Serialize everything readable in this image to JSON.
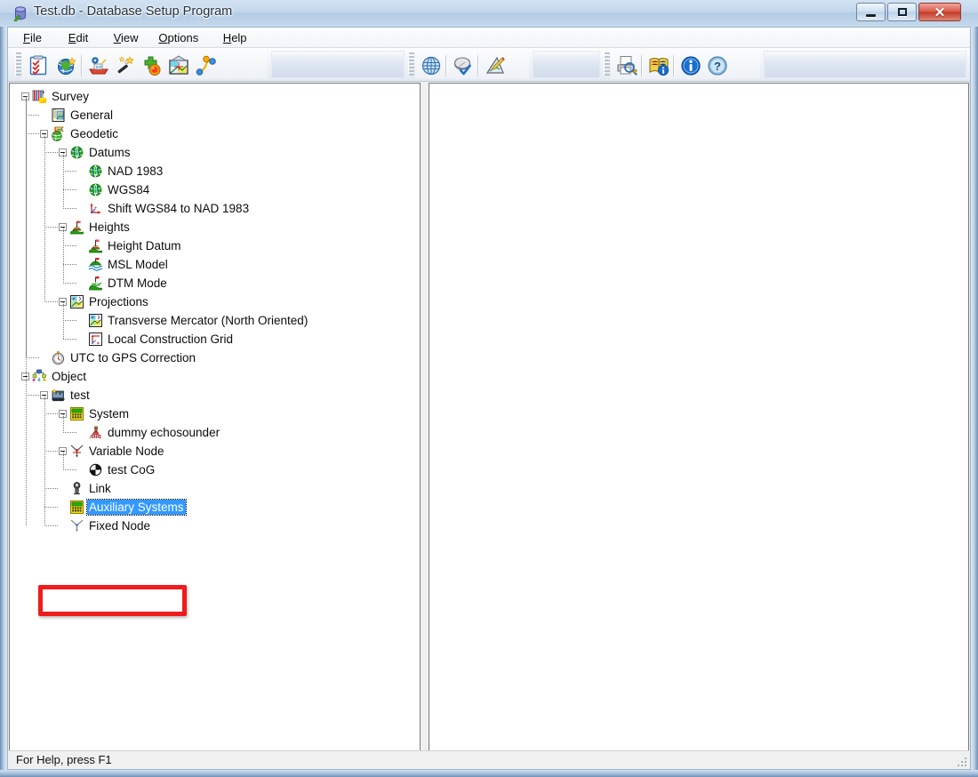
{
  "window": {
    "title": "Test.db - Database Setup Program",
    "icon": "database-cylinder-icon",
    "controls": {
      "minimize": "Minimize",
      "maximize": "Maximize",
      "close": "Close",
      "close_glyph": "✕"
    }
  },
  "menu": {
    "items": [
      {
        "pre": "",
        "accel": "F",
        "post": "ile"
      },
      {
        "pre": "",
        "accel": "E",
        "post": "dit"
      },
      {
        "pre": "",
        "accel": "V",
        "post": "iew"
      },
      {
        "pre": "",
        "accel": "O",
        "post": "ptions"
      },
      {
        "pre": "",
        "accel": "H",
        "post": "elp"
      }
    ]
  },
  "toolbar": {
    "groups": [
      {
        "name": "edit-group",
        "buttons": [
          {
            "icon": "checklist-clipboard-icon",
            "label": "Survey Settings"
          },
          {
            "icon": "globe-wand-icon",
            "label": "Geodetic Wizard"
          },
          {
            "icon": "vessel-icon",
            "label": "Vessel"
          },
          {
            "icon": "magic-wand-icon",
            "label": "Wizard"
          },
          {
            "icon": "add-node-icon",
            "label": "Add Node"
          },
          {
            "icon": "projection-grid-icon",
            "label": "Projection"
          },
          {
            "icon": "link-nodes-icon",
            "label": "Link Nodes"
          }
        ]
      },
      {
        "name": "geodetic-group",
        "buttons": [
          {
            "icon": "globe-wire-icon",
            "label": "Geodetics"
          },
          {
            "icon": "satellite-check-icon",
            "label": "Verify"
          },
          {
            "icon": "ruler-pencil-icon",
            "label": "Measure"
          }
        ]
      },
      {
        "name": "help-group",
        "buttons": [
          {
            "icon": "print-preview-icon",
            "label": "Print Preview"
          },
          {
            "icon": "book-info-icon",
            "label": "Reference"
          },
          {
            "icon": "info-icon",
            "label": "About"
          },
          {
            "icon": "help-question-icon",
            "label": "Help"
          }
        ]
      }
    ]
  },
  "tree": {
    "nodes": [
      {
        "label": "Survey",
        "depth": 0,
        "icon": "survey-icon",
        "expander": "minus",
        "selected": false
      },
      {
        "label": "General",
        "depth": 1,
        "icon": "general-notepad-icon",
        "expander": "none",
        "selected": false
      },
      {
        "label": "Geodetic",
        "depth": 1,
        "icon": "geodetic-globe-icon",
        "expander": "minus",
        "selected": false
      },
      {
        "label": "Datums",
        "depth": 2,
        "icon": "datum-globe-icon",
        "expander": "minus",
        "selected": false
      },
      {
        "label": "NAD 1983",
        "depth": 3,
        "icon": "datum-globe-icon",
        "expander": "none",
        "selected": false
      },
      {
        "label": "WGS84",
        "depth": 3,
        "icon": "datum-globe-icon",
        "expander": "none",
        "selected": false
      },
      {
        "label": "Shift WGS84 to NAD 1983",
        "depth": 3,
        "icon": "shift-axes-icon",
        "expander": "none",
        "selected": false
      },
      {
        "label": "Heights",
        "depth": 2,
        "icon": "height-datum-icon",
        "expander": "minus",
        "selected": false
      },
      {
        "label": "Height Datum",
        "depth": 3,
        "icon": "height-datum-icon",
        "expander": "none",
        "selected": false
      },
      {
        "label": "MSL Model",
        "depth": 3,
        "icon": "msl-model-icon",
        "expander": "none",
        "selected": false
      },
      {
        "label": "DTM Mode",
        "depth": 3,
        "icon": "dtm-mode-icon",
        "expander": "none",
        "selected": false
      },
      {
        "label": "Projections",
        "depth": 2,
        "icon": "projection-grid-icon",
        "expander": "minus",
        "selected": false
      },
      {
        "label": "Transverse Mercator (North Oriented)",
        "depth": 3,
        "icon": "projection-grid-icon",
        "expander": "none",
        "selected": false
      },
      {
        "label": "Local Construction Grid",
        "depth": 3,
        "icon": "local-grid-icon",
        "expander": "none",
        "selected": false
      },
      {
        "label": "UTC to GPS Correction",
        "depth": 1,
        "icon": "clock-icon",
        "expander": "none",
        "selected": false
      },
      {
        "label": "Object",
        "depth": 0,
        "icon": "object-network-icon",
        "expander": "minus",
        "selected": false
      },
      {
        "label": "test",
        "depth": 1,
        "icon": "vessel-chart-icon",
        "expander": "minus",
        "selected": false
      },
      {
        "label": "System",
        "depth": 2,
        "icon": "system-device-icon",
        "expander": "minus",
        "selected": false
      },
      {
        "label": "dummy echosounder",
        "depth": 3,
        "icon": "echosounder-icon",
        "expander": "none",
        "selected": false
      },
      {
        "label": "Variable Node",
        "depth": 2,
        "icon": "variable-node-icon",
        "expander": "minus",
        "selected": false
      },
      {
        "label": "test CoG",
        "depth": 3,
        "icon": "cog-sphere-icon",
        "expander": "none",
        "selected": false
      },
      {
        "label": "Link",
        "depth": 2,
        "icon": "link-icon",
        "expander": "none",
        "selected": false
      },
      {
        "label": "Auxiliary Systems",
        "depth": 2,
        "icon": "system-device-icon",
        "expander": "none",
        "selected": true
      },
      {
        "label": "Fixed Node",
        "depth": 2,
        "icon": "fixed-node-icon",
        "expander": "none",
        "selected": false
      }
    ]
  },
  "annotation": {
    "name": "red-highlight-rectangle",
    "color": "#ee1c1c",
    "targets": "Auxiliary Systems"
  },
  "statusbar": {
    "text": "For Help, press F1"
  }
}
